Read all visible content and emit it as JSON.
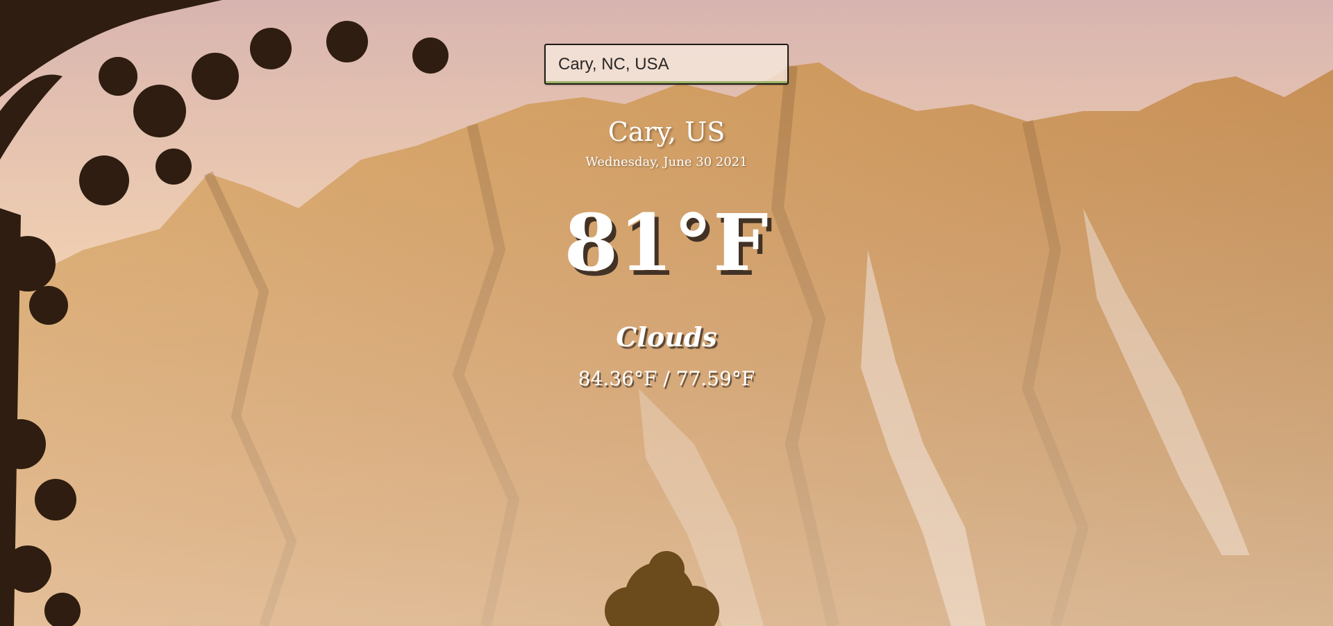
{
  "search": {
    "value": "Cary, NC, USA"
  },
  "weather": {
    "location": "Cary, US",
    "date": "Wednesday, June 30 2021",
    "temperature": "81°F",
    "condition": "Clouds",
    "hi_lo": "84.36°F / 77.59°F"
  },
  "background": {
    "subject": "sunlit mountain range with trees",
    "sky_color": "#e9c7b0",
    "mountain_color": "#c98d52"
  }
}
